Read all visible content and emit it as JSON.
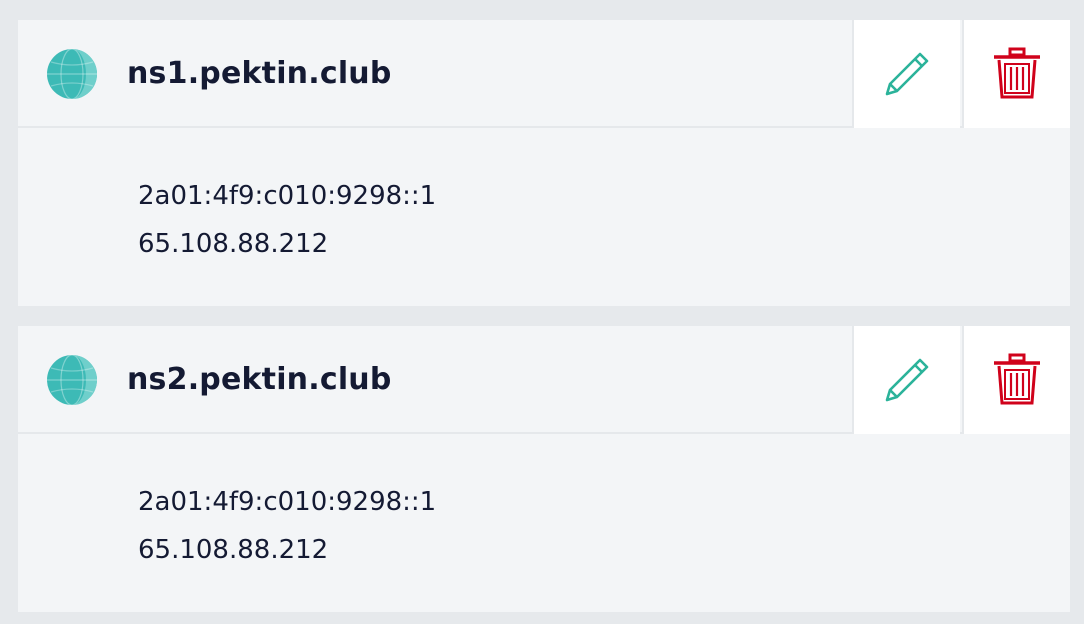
{
  "records": [
    {
      "host": "ns1.pektin.club",
      "ips": [
        "2a01:4f9:c010:9298::1",
        "65.108.88.212"
      ]
    },
    {
      "host": "ns2.pektin.club",
      "ips": [
        "2a01:4f9:c010:9298::1",
        "65.108.88.212"
      ]
    }
  ],
  "icons": {
    "globe": "globe-icon",
    "edit": "pencil-icon",
    "delete": "trash-icon"
  },
  "colors": {
    "background": "#e6e9ec",
    "card": "#f3f5f7",
    "text": "#141a33",
    "edit_icon": "#2bb39a",
    "delete_icon": "#d0021b",
    "globe": "#3dbab6"
  }
}
